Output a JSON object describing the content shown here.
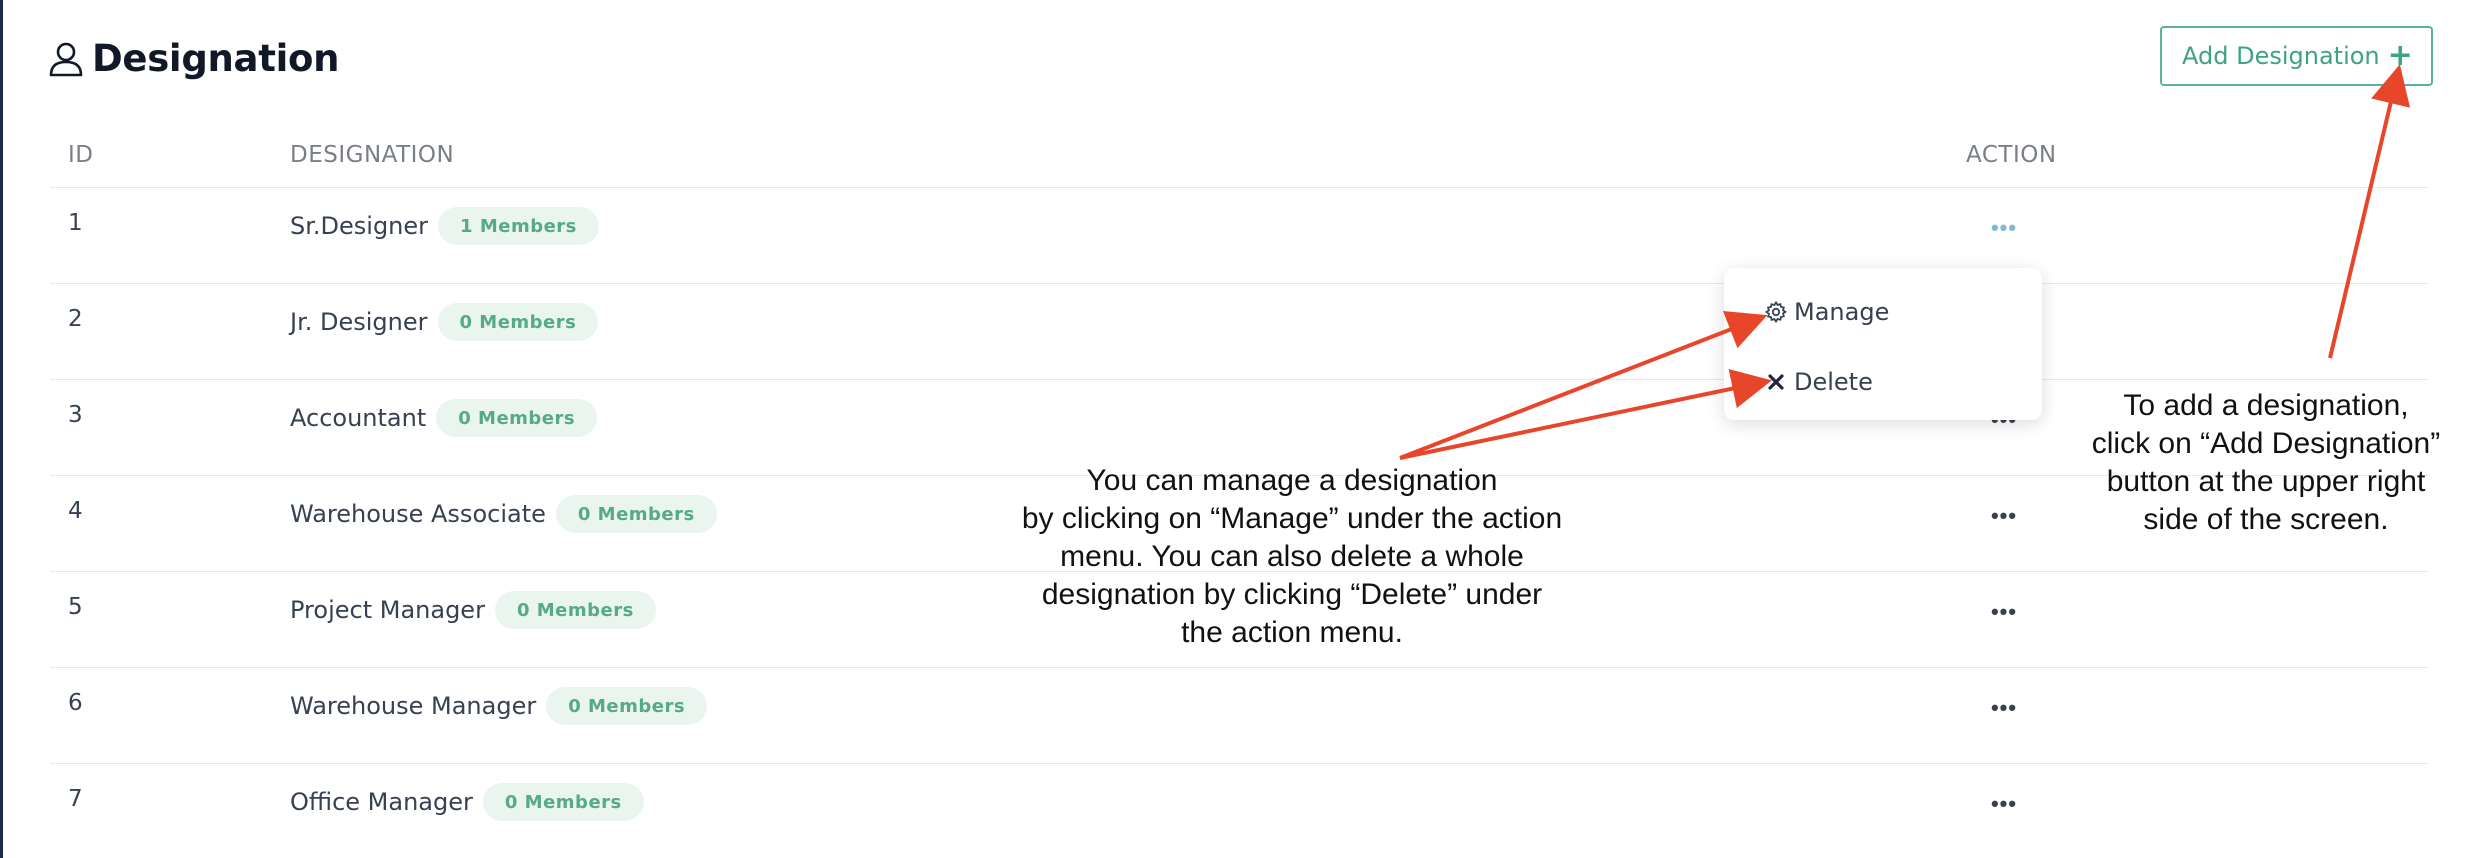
{
  "header": {
    "icon": "user-icon",
    "title": "Designation",
    "add_button_label": "Add Designation",
    "add_button_icon": "plus-icon"
  },
  "table": {
    "columns": [
      "ID",
      "DESIGNATION",
      "ACTION"
    ],
    "rows": [
      {
        "id": "1",
        "name": "Sr.Designer",
        "badge": "1 Members",
        "action": "•••"
      },
      {
        "id": "2",
        "name": "Jr. Designer",
        "badge": "0 Members",
        "action": "•••"
      },
      {
        "id": "3",
        "name": "Accountant",
        "badge": "0 Members",
        "action": "•••"
      },
      {
        "id": "4",
        "name": "Warehouse Associate",
        "badge": "0 Members",
        "action": "•••"
      },
      {
        "id": "5",
        "name": "Project Manager",
        "badge": "0 Members",
        "action": "•••"
      },
      {
        "id": "6",
        "name": "Warehouse Manager",
        "badge": "0 Members",
        "action": "•••"
      },
      {
        "id": "7",
        "name": "Office Manager",
        "badge": "0 Members",
        "action": "•••"
      }
    ]
  },
  "action_menu": {
    "items": [
      {
        "label": "Manage",
        "icon": "gear-icon"
      },
      {
        "label": "Delete",
        "icon": "close-icon"
      }
    ]
  },
  "annotations": {
    "center": "You can manage a designation\nby clicking on “Manage” under the action\nmenu. You can also delete a whole\ndesignation by clicking “Delete” under\nthe action menu.",
    "right": "To add a designation,\nclick on “Add Designation”\nbutton at the upper right\nside of the screen."
  },
  "colors": {
    "accent": "#3fa37f",
    "badge_bg": "#eaf5f0",
    "arrow": "#e8462a",
    "sidebar_edge": "#1e2a4a"
  }
}
